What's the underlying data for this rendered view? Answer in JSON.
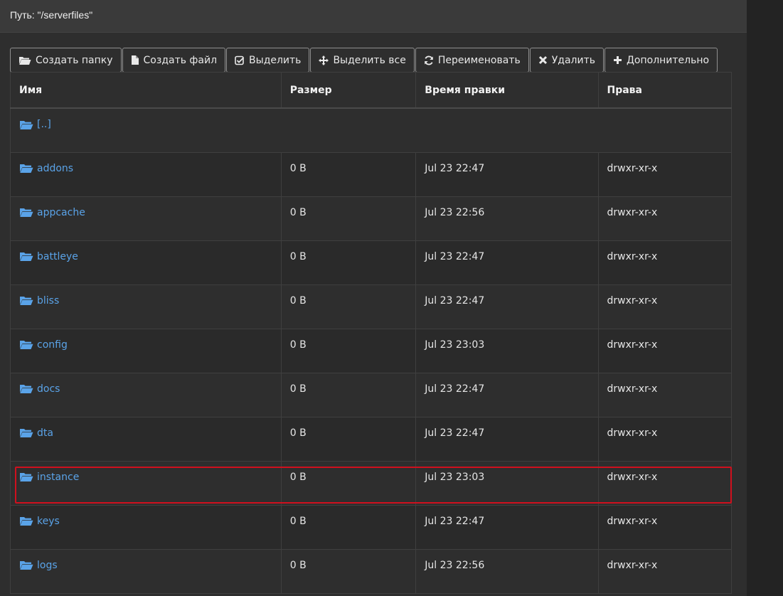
{
  "path": {
    "text": "Путь: \"/serverfiles\""
  },
  "toolbar": {
    "create_folder": "Создать папку",
    "create_file": "Создать файл",
    "select": "Выделить",
    "select_all": "Выделить все",
    "rename": "Переименовать",
    "delete": "Удалить",
    "more": "Дополнительно"
  },
  "table": {
    "headers": {
      "name": "Имя",
      "size": "Размер",
      "time": "Время правки",
      "perm": "Права"
    },
    "parent": "[..]",
    "rows": [
      {
        "name": "addons",
        "size": "0 B",
        "time": "Jul 23 22:47",
        "perm": "drwxr-xr-x"
      },
      {
        "name": "appcache",
        "size": "0 B",
        "time": "Jul 23 22:56",
        "perm": "drwxr-xr-x"
      },
      {
        "name": "battleye",
        "size": "0 B",
        "time": "Jul 23 22:47",
        "perm": "drwxr-xr-x"
      },
      {
        "name": "bliss",
        "size": "0 B",
        "time": "Jul 23 22:47",
        "perm": "drwxr-xr-x"
      },
      {
        "name": "config",
        "size": "0 B",
        "time": "Jul 23 23:03",
        "perm": "drwxr-xr-x"
      },
      {
        "name": "docs",
        "size": "0 B",
        "time": "Jul 23 22:47",
        "perm": "drwxr-xr-x"
      },
      {
        "name": "dta",
        "size": "0 B",
        "time": "Jul 23 22:47",
        "perm": "drwxr-xr-x"
      },
      {
        "name": "instance",
        "size": "0 B",
        "time": "Jul 23 23:03",
        "perm": "drwxr-xr-x"
      },
      {
        "name": "keys",
        "size": "0 B",
        "time": "Jul 23 22:47",
        "perm": "drwxr-xr-x"
      },
      {
        "name": "logs",
        "size": "0 B",
        "time": "Jul 23 22:56",
        "perm": "drwxr-xr-x"
      }
    ]
  },
  "icons": {
    "folder": "folder-open-icon",
    "file": "file-icon",
    "check": "check-square-icon",
    "move": "arrows-move-icon",
    "refresh": "refresh-icon",
    "close": "close-icon",
    "plus": "plus-icon"
  },
  "colors": {
    "link": "#5aa3e8",
    "highlight": "#d0101e"
  }
}
